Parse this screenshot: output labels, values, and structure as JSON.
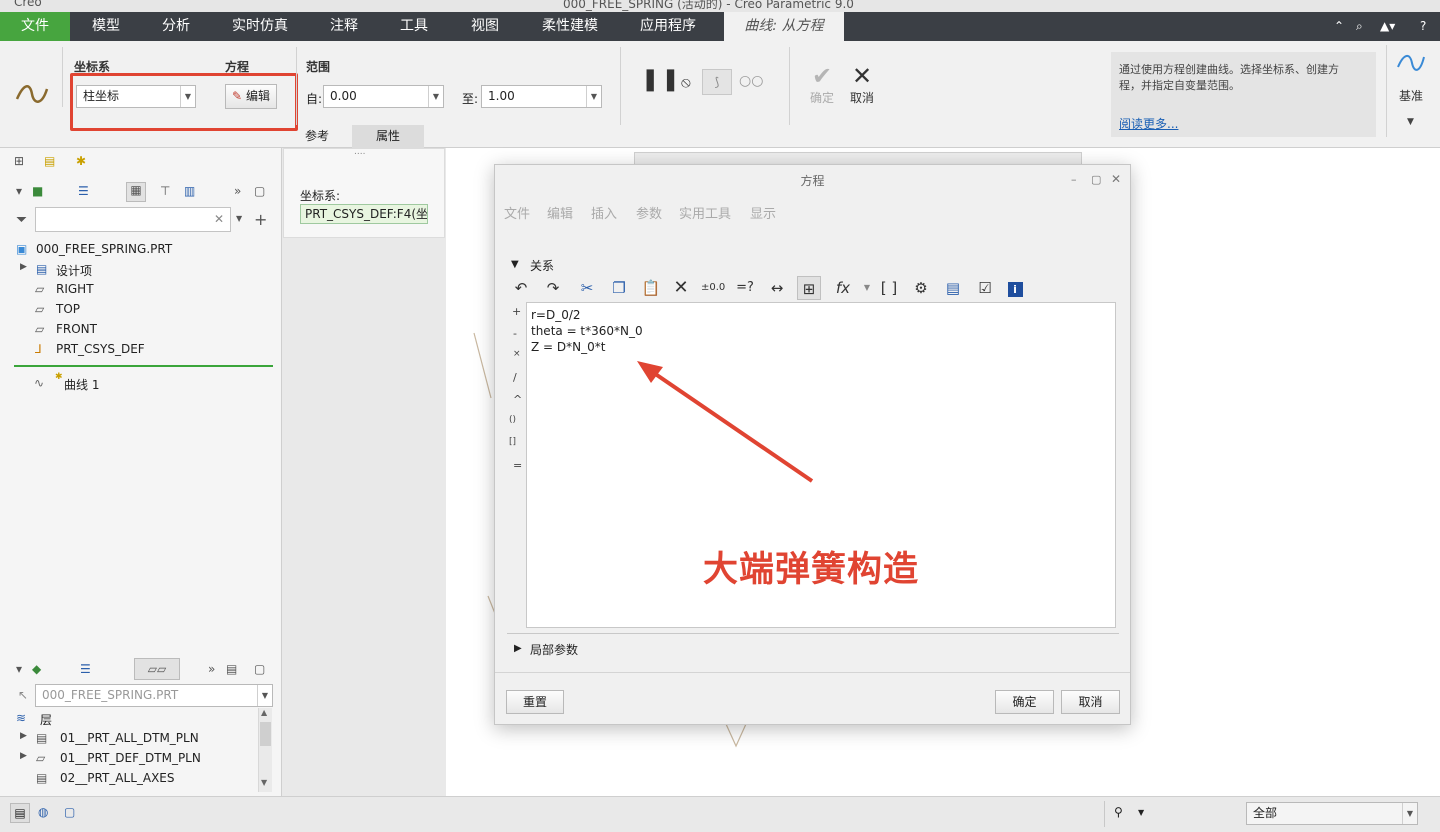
{
  "titlebar": {
    "app_name": "Creo",
    "window_title": "000_FREE_SPRING (活动的) - Creo Parametric 9.0"
  },
  "ribbon_tabs": [
    {
      "label": "文件"
    },
    {
      "label": "模型"
    },
    {
      "label": "分析"
    },
    {
      "label": "实时仿真"
    },
    {
      "label": "注释"
    },
    {
      "label": "工具"
    },
    {
      "label": "视图"
    },
    {
      "label": "柔性建模"
    },
    {
      "label": "应用程序"
    },
    {
      "label": "曲线: 从方程"
    }
  ],
  "ribbon": {
    "csys_group_label": "坐标系",
    "csys_type_value": "柱坐标",
    "equation_group_label": "方程",
    "edit_button_label": "编辑",
    "range_group_label": "范围",
    "from_label": "自:",
    "from_value": "0.00",
    "to_label": "至:",
    "to_value": "1.00",
    "ok_label": "确定",
    "cancel_label": "取消",
    "help_text": "通过使用方程创建曲线。选择坐标系、创建方程，并指定自变量范围。",
    "read_more_label": "阅读更多...",
    "datum_label": "基准",
    "subtabs": [
      "参考",
      "属性"
    ]
  },
  "ref_panel": {
    "dots": "....",
    "csys_label": "坐标系:",
    "csys_value": "PRT_CSYS_DEF:F4(坐"
  },
  "model_tree": {
    "root": "000_FREE_SPRING.PRT",
    "items": [
      {
        "label": "设计项",
        "icon": "design-items-icon"
      },
      {
        "label": "RIGHT",
        "icon": "datum-plane-icon"
      },
      {
        "label": "TOP",
        "icon": "datum-plane-icon"
      },
      {
        "label": "FRONT",
        "icon": "datum-plane-icon"
      },
      {
        "label": "PRT_CSYS_DEF",
        "icon": "csys-icon"
      }
    ],
    "new_feature": "曲线 1"
  },
  "layer_tree": {
    "model_selector": "000_FREE_SPRING.PRT",
    "header": "层",
    "items": [
      {
        "label": "01__PRT_ALL_DTM_PLN"
      },
      {
        "label": "01__PRT_DEF_DTM_PLN"
      },
      {
        "label": "02__PRT_ALL_AXES"
      }
    ]
  },
  "dialog": {
    "title": "方程",
    "menu": [
      "文件",
      "编辑",
      "插入",
      "参数",
      "实用工具",
      "显示"
    ],
    "relations_label": "关系",
    "equation_lines": [
      "r=D_0/2",
      "theta = t*360*N_0",
      "Z = D*N_0*t"
    ],
    "operator_keys": [
      "+",
      "-",
      "×",
      "/",
      "^",
      "()",
      "[]",
      "="
    ],
    "local_params_label": "局部参数",
    "reset_label": "重置",
    "ok_label": "确定",
    "cancel_label": "取消",
    "annotation": "大端弹簧构造"
  },
  "statusbar": {
    "filter_value": "全部"
  },
  "colors": {
    "file_tab": "#47a53f",
    "tabbar": "#3b3f45",
    "highlight_red": "#e04432",
    "link_blue": "#1a5fb4",
    "annotation_red": "#e04432"
  }
}
